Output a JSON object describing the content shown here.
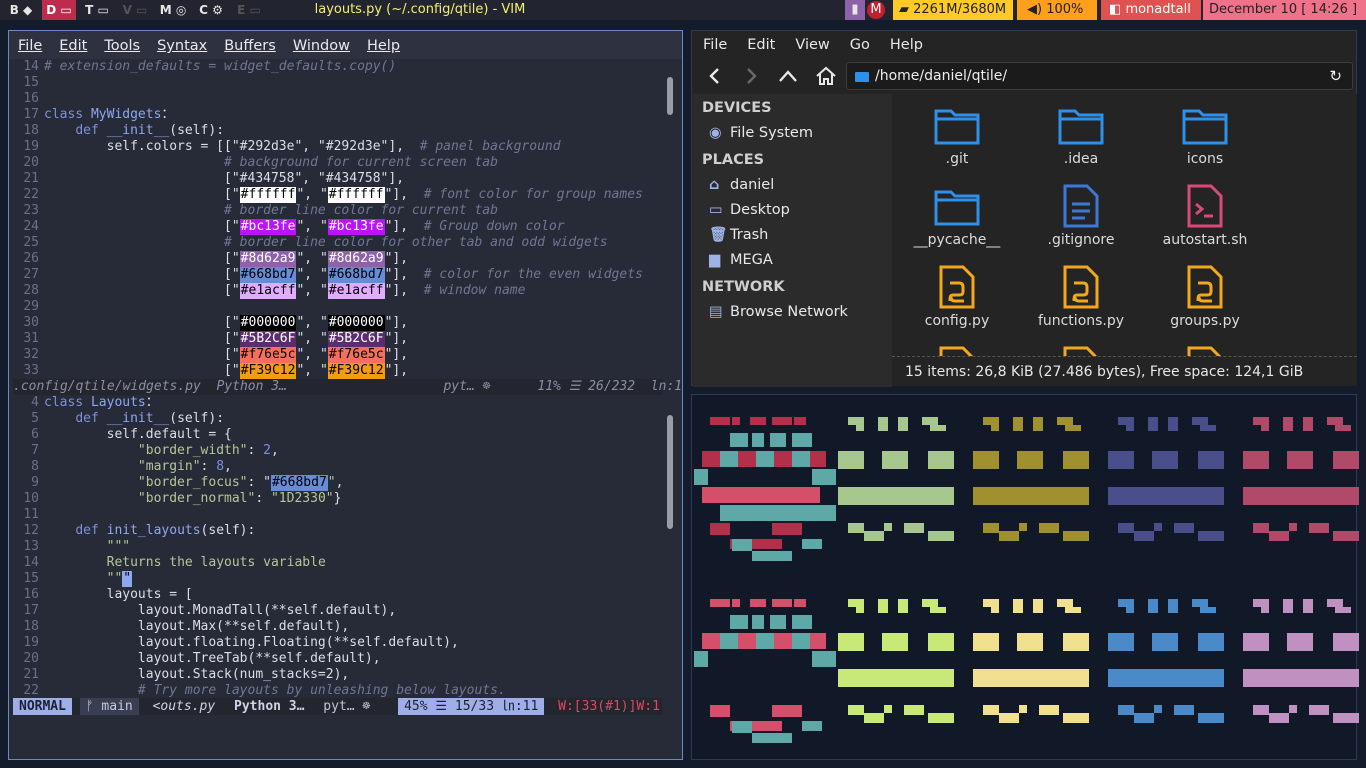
{
  "topbar": {
    "groups": [
      {
        "label": "B ◆",
        "active": false
      },
      {
        "label": "D ▭",
        "active": true
      },
      {
        "label": "T ▭",
        "active": false
      },
      {
        "label": "V ▭",
        "active": false,
        "dim": true
      },
      {
        "label": "M ◎",
        "active": false
      },
      {
        "label": "C ⚙",
        "active": false
      },
      {
        "label": "E ▭",
        "active": false,
        "dim": true
      }
    ],
    "window_title": "layouts.py (~/.config/qtile) - VIM",
    "memory": "2261M/3680M",
    "volume": "100%",
    "layout": "monadtall",
    "date": "December 10  [ 14:26 ]",
    "colors": {
      "active_group": "#bc2d4d",
      "memory": "#ffca28",
      "volume": "#ff9f1c",
      "layout": "#e05252",
      "date": "#f0718a"
    }
  },
  "vim": {
    "menu": [
      "File",
      "Edit",
      "Tools",
      "Syntax",
      "Buffers",
      "Window",
      "Help"
    ],
    "top_lines": [
      {
        "n": "14",
        "t": [
          [
            "cm",
            "# extension_defaults = widget_defaults.copy()"
          ]
        ]
      },
      {
        "n": "15",
        "t": []
      },
      {
        "n": "16",
        "t": []
      },
      {
        "n": "17",
        "t": [
          [
            "kw",
            "class "
          ],
          [
            "fn",
            "MyWidgets"
          ],
          [
            "",
            "："
          ]
        ]
      },
      {
        "n": "18",
        "t": [
          [
            "",
            "    "
          ],
          [
            "kw",
            "def "
          ],
          [
            "fn",
            "__init__"
          ],
          [
            "",
            "(self):"
          ]
        ]
      },
      {
        "n": "19",
        "t": [
          [
            "",
            "        self.colors = [[\"#292d3e\", \"#292d3e\"],  "
          ],
          [
            "cm",
            "# panel background"
          ]
        ]
      },
      {
        "n": "20",
        "t": [
          [
            "",
            "                       "
          ],
          [
            "cm",
            "# background for current screen tab"
          ]
        ]
      },
      {
        "n": "21",
        "t": [
          [
            "",
            "                       [\"#434758\", \"#434758\"],"
          ]
        ]
      },
      {
        "n": "22",
        "t": [
          [
            "",
            "                       [\""
          ],
          [
            "sw:#ffffff:#000",
            "#ffffff"
          ],
          [
            "",
            "\", \""
          ],
          [
            "sw:#ffffff:#000",
            "#ffffff"
          ],
          [
            "",
            "\"],  "
          ],
          [
            "cm",
            "# font color for group names"
          ]
        ]
      },
      {
        "n": "23",
        "t": [
          [
            "",
            "                       "
          ],
          [
            "cm",
            "# border line color for current tab"
          ]
        ]
      },
      {
        "n": "24",
        "t": [
          [
            "",
            "                       [\""
          ],
          [
            "sw:#bc13fe:#fff",
            "#bc13fe"
          ],
          [
            "",
            "\", \""
          ],
          [
            "sw:#bc13fe:#fff",
            "#bc13fe"
          ],
          [
            "",
            "\"],  "
          ],
          [
            "cm",
            "# Group down color"
          ]
        ]
      },
      {
        "n": "25",
        "t": [
          [
            "",
            "                       "
          ],
          [
            "cm",
            "# border line color for other tab and odd widgets"
          ]
        ]
      },
      {
        "n": "26",
        "t": [
          [
            "",
            "                       [\""
          ],
          [
            "sw:#8d62a9:#fff",
            "#8d62a9"
          ],
          [
            "",
            "\", \""
          ],
          [
            "sw:#8d62a9:#fff",
            "#8d62a9"
          ],
          [
            "",
            "\"],"
          ]
        ]
      },
      {
        "n": "27",
        "t": [
          [
            "",
            "                       [\""
          ],
          [
            "sw:#668bd7:#000",
            "#668bd7"
          ],
          [
            "",
            "\", \""
          ],
          [
            "sw:#668bd7:#000",
            "#668bd7"
          ],
          [
            "",
            "\"],  "
          ],
          [
            "cm",
            "# color for the even widgets"
          ]
        ]
      },
      {
        "n": "28",
        "t": [
          [
            "",
            "                       [\""
          ],
          [
            "sw:#e1acff:#000",
            "#e1acff"
          ],
          [
            "",
            "\", \""
          ],
          [
            "sw:#e1acff:#000",
            "#e1acff"
          ],
          [
            "",
            "\"],  "
          ],
          [
            "cm",
            "# window name"
          ]
        ]
      },
      {
        "n": "29",
        "t": []
      },
      {
        "n": "30",
        "t": [
          [
            "",
            "                       [\""
          ],
          [
            "sw:#000000:#fff",
            "#000000"
          ],
          [
            "",
            "\", \""
          ],
          [
            "sw:#000000:#fff",
            "#000000"
          ],
          [
            "",
            "\"],"
          ]
        ]
      },
      {
        "n": "31",
        "t": [
          [
            "",
            "                       [\""
          ],
          [
            "sw:#5B2C6F:#fff",
            "#5B2C6F"
          ],
          [
            "",
            "\", \""
          ],
          [
            "sw:#5B2C6F:#fff",
            "#5B2C6F"
          ],
          [
            "",
            "\"],"
          ]
        ]
      },
      {
        "n": "32",
        "t": [
          [
            "",
            "                       [\""
          ],
          [
            "sw:#f76e5c:#000",
            "#f76e5c"
          ],
          [
            "",
            "\", \""
          ],
          [
            "sw:#f76e5c:#000",
            "#f76e5c"
          ],
          [
            "",
            "\"],"
          ]
        ]
      },
      {
        "n": "33",
        "t": [
          [
            "",
            "                       [\""
          ],
          [
            "sw:#F39C12:#000",
            "#F39C12"
          ],
          [
            "",
            "\", \""
          ],
          [
            "sw:#F39C12:#000",
            "#F39C12"
          ],
          [
            "",
            "\"],"
          ]
        ]
      }
    ],
    "top_status": ".config/qtile/widgets.py  Python 3…                    pyt… ☸      11% ☰ 26/232  ln:1",
    "bottom_lines": [
      {
        "n": "4",
        "t": [
          [
            "kw",
            "class "
          ],
          [
            "fn",
            "Layouts"
          ],
          [
            "",
            "："
          ]
        ]
      },
      {
        "n": "5",
        "t": [
          [
            "",
            "    "
          ],
          [
            "kw",
            "def "
          ],
          [
            "fn",
            "__init__"
          ],
          [
            "",
            "(self):"
          ]
        ]
      },
      {
        "n": "6",
        "t": [
          [
            "",
            "        self.default = {"
          ]
        ]
      },
      {
        "n": "7",
        "t": [
          [
            "",
            "            "
          ],
          [
            "st",
            "\"border_width\""
          ],
          [
            "",
            ": "
          ],
          [
            "kw",
            "2"
          ],
          [
            "",
            ","
          ]
        ]
      },
      {
        "n": "8",
        "t": [
          [
            "",
            "            "
          ],
          [
            "st",
            "\"margin\""
          ],
          [
            "",
            ": "
          ],
          [
            "kw",
            "8"
          ],
          [
            "",
            ","
          ]
        ]
      },
      {
        "n": "9",
        "t": [
          [
            "",
            "            "
          ],
          [
            "st",
            "\"border_focus\""
          ],
          [
            "",
            ": \""
          ],
          [
            "sw:#668bd7:#000",
            "#668bd7"
          ],
          [
            "st",
            "\""
          ],
          [
            "",
            ","
          ]
        ]
      },
      {
        "n": "10",
        "t": [
          [
            "",
            "            "
          ],
          [
            "st",
            "\"border_normal\""
          ],
          [
            "",
            ": "
          ],
          [
            "st",
            "\"1D2330\""
          ],
          [
            "",
            "}"
          ]
        ]
      },
      {
        "n": "11",
        "t": []
      },
      {
        "n": "12",
        "t": [
          [
            "",
            "    "
          ],
          [
            "kw",
            "def "
          ],
          [
            "fn",
            "init_layouts"
          ],
          [
            "",
            "(self):"
          ]
        ]
      },
      {
        "n": "13",
        "t": [
          [
            "",
            "        "
          ],
          [
            "st",
            "\"\"\""
          ]
        ]
      },
      {
        "n": "14",
        "t": [
          [
            "",
            "        "
          ],
          [
            "st",
            "Returns the layouts variable"
          ]
        ]
      },
      {
        "n": "15",
        "t": [
          [
            "",
            "        "
          ],
          [
            "st",
            "\"\""
          ],
          [
            "sw:#8ea7ef:#000",
            "\""
          ]
        ]
      },
      {
        "n": "16",
        "t": [
          [
            "",
            "        layouts = ["
          ]
        ]
      },
      {
        "n": "17",
        "t": [
          [
            "",
            "            layout.MonadTall(**self.default),"
          ]
        ]
      },
      {
        "n": "18",
        "t": [
          [
            "",
            "            layout.Max(**self.default),"
          ]
        ]
      },
      {
        "n": "19",
        "t": [
          [
            "",
            "            layout.floating.Floating(**self.default),"
          ]
        ]
      },
      {
        "n": "20",
        "t": [
          [
            "",
            "            layout.TreeTab(**self.default),"
          ]
        ]
      },
      {
        "n": "21",
        "t": [
          [
            "",
            "            layout.Stack(num_stacks=2),"
          ]
        ]
      },
      {
        "n": "22",
        "t": [
          [
            "",
            "            "
          ],
          [
            "cm",
            "# Try more layouts by unleashing below layouts."
          ]
        ]
      }
    ],
    "status": {
      "mode": "NORMAL",
      "branch": "ᚠ main",
      "file": "<outs.py",
      "filetype": "Python 3…",
      "fmt": "pyt… ☸",
      "pos": "45% ☰ 15/33 ㏑:11",
      "warn": "W:[33(#1)]W:1"
    }
  },
  "fm": {
    "menu": [
      "File",
      "Edit",
      "View",
      "Go",
      "Help"
    ],
    "path": "/home/daniel/qtile/",
    "sections": [
      {
        "title": "DEVICES",
        "items": [
          {
            "icon": "◉",
            "label": "File System"
          }
        ]
      },
      {
        "title": "PLACES",
        "items": [
          {
            "icon": "⌂",
            "label": "daniel"
          },
          {
            "icon": "▭",
            "label": "Desktop"
          },
          {
            "icon": "🗑",
            "label": "Trash"
          },
          {
            "icon": "▆",
            "label": "MEGA"
          }
        ]
      },
      {
        "title": "NETWORK",
        "items": [
          {
            "icon": "▤",
            "label": "Browse Network"
          }
        ]
      }
    ],
    "files": [
      {
        "name": ".git",
        "kind": "folder"
      },
      {
        "name": ".idea",
        "kind": "folder"
      },
      {
        "name": "icons",
        "kind": "folder"
      },
      {
        "name": "__pycache__",
        "kind": "folder"
      },
      {
        "name": ".gitignore",
        "kind": "text"
      },
      {
        "name": "autostart.sh",
        "kind": "script"
      },
      {
        "name": "config.py",
        "kind": "python"
      },
      {
        "name": "functions.py",
        "kind": "python"
      },
      {
        "name": "groups.py",
        "kind": "python"
      }
    ],
    "status": "15 items: 26,8 KiB (27.486 bytes), Free space: 124,1 GiB"
  },
  "term": {
    "palette_rows": [
      [
        "#b3304a",
        "#a8c78f",
        "#a09030",
        "#4a4f8c",
        "#b04a68"
      ],
      [
        "#d4506a",
        "#c8e878",
        "#f0e090",
        "#4a8ac8",
        "#c090c0"
      ]
    ],
    "accent": "#5fa8a8"
  }
}
